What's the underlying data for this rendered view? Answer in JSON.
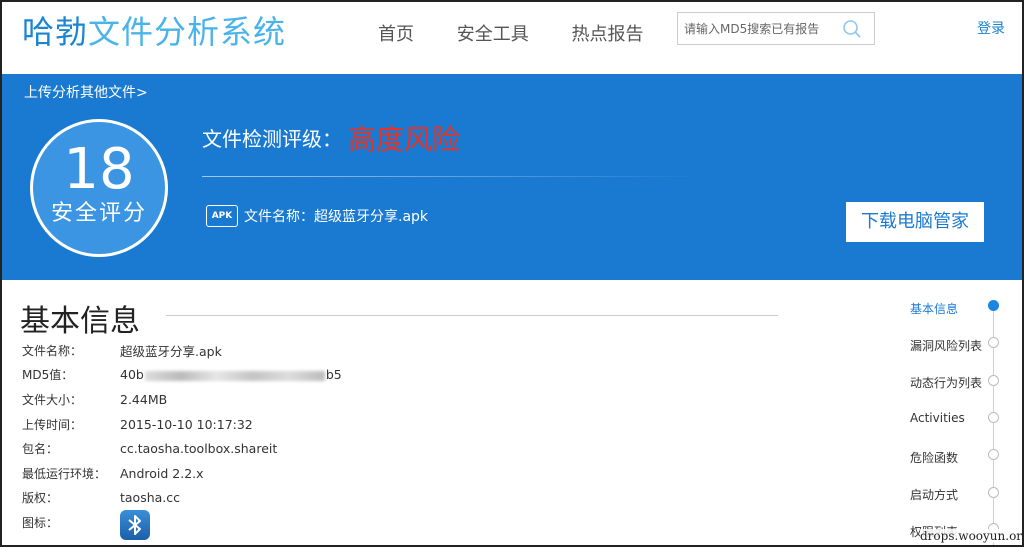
{
  "header": {
    "logo_part1": "哈勃",
    "logo_part2": "文件分析系统",
    "nav": [
      "首页",
      "安全工具",
      "热点报告"
    ],
    "search_placeholder": "请输入MD5搜索已有报告",
    "login": "登录"
  },
  "banner": {
    "upload_link": "上传分析其他文件>",
    "score": "18",
    "score_label": "安全评分",
    "rating_label": "文件检测评级：",
    "rating_value": "高度风险",
    "apk_badge": "APK",
    "file_label": "文件名称：",
    "file_name": "超级蓝牙分享.apk",
    "download_button": "下载电脑管家"
  },
  "basic_info": {
    "title": "基本信息",
    "rows": [
      {
        "key": "文件名称：",
        "value": "超级蓝牙分享.apk"
      },
      {
        "key": "MD5值：",
        "value_prefix": "40b",
        "value_suffix": "b5"
      },
      {
        "key": "文件大小：",
        "value": "2.44MB"
      },
      {
        "key": "上传时间：",
        "value": "2015-10-10 10:17:32"
      },
      {
        "key": "包名：",
        "value": "cc.taosha.toolbox.shareit"
      },
      {
        "key": "最低运行环境：",
        "value": "Android 2.2.x"
      },
      {
        "key": "版权：",
        "value": "taosha.cc"
      },
      {
        "key": "图标：",
        "value": ""
      }
    ]
  },
  "side_nav": {
    "items": [
      "基本信息",
      "漏洞风险列表",
      "动态行为列表",
      "Activities",
      "危险函数",
      "启动方式",
      "权限列表"
    ],
    "active_index": 0
  },
  "watermark": "drops.wooyun.org",
  "colors": {
    "brand_blue": "#1a7ad1",
    "risk_red": "#e43326"
  }
}
